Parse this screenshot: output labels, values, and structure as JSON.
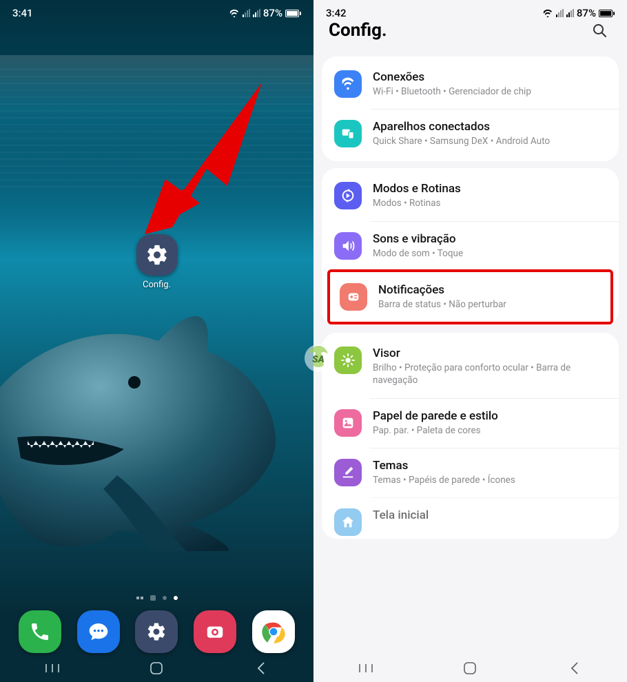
{
  "left": {
    "status": {
      "time": "3:41",
      "battery_pct": "87%"
    },
    "center_app": {
      "label": "Config."
    },
    "dock": [
      {
        "name": "phone"
      },
      {
        "name": "messages"
      },
      {
        "name": "settings"
      },
      {
        "name": "camera"
      },
      {
        "name": "chrome"
      }
    ]
  },
  "right": {
    "status": {
      "time": "3:42",
      "battery_pct": "87%"
    },
    "header": {
      "title": "Config."
    },
    "groups": [
      {
        "items": [
          {
            "icon": "wifi",
            "color": "blue",
            "title": "Conexões",
            "sub": "Wi-Fi  •  Bluetooth  •  Gerenciador de chip"
          },
          {
            "icon": "devices",
            "color": "teal",
            "title": "Aparelhos conectados",
            "sub": "Quick Share  •  Samsung DeX  •  Android Auto"
          }
        ]
      },
      {
        "items": [
          {
            "icon": "routines",
            "color": "indigo",
            "title": "Modos e Rotinas",
            "sub": "Modos  •  Rotinas"
          },
          {
            "icon": "sound",
            "color": "purple",
            "title": "Sons e vibração",
            "sub": "Modo de som  •  Toque"
          },
          {
            "icon": "notify",
            "color": "coral",
            "title": "Notificações",
            "sub": "Barra de status  •  Não perturbar",
            "highlighted": true
          }
        ]
      },
      {
        "items": [
          {
            "icon": "display",
            "color": "green",
            "title": "Visor",
            "sub": "Brilho  •  Proteção para conforto ocular  •  Barra de navegação"
          },
          {
            "icon": "wallpaper",
            "color": "pink",
            "title": "Papel de parede e estilo",
            "sub": "Pap. par.  •  Paleta de cores"
          },
          {
            "icon": "themes",
            "color": "violet",
            "title": "Temas",
            "sub": "Temas  •  Papéis de parede  •  Ícones"
          },
          {
            "icon": "home",
            "color": "sky",
            "title": "Tela inicial",
            "sub": ""
          }
        ]
      }
    ]
  }
}
